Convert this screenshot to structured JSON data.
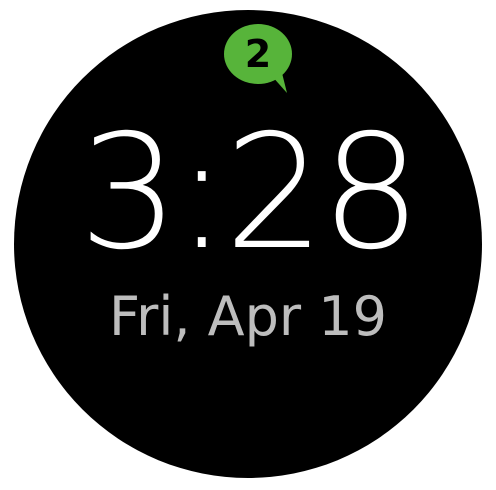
{
  "notification": {
    "count": "2",
    "badge_color": "#57b43a",
    "icon": "speech-bubble-icon"
  },
  "clock": {
    "time": "3:28",
    "date": "Fri, Apr 19"
  },
  "colors": {
    "face": "#000000",
    "time_text": "#ffffff",
    "date_text": "#bdbdbd"
  }
}
